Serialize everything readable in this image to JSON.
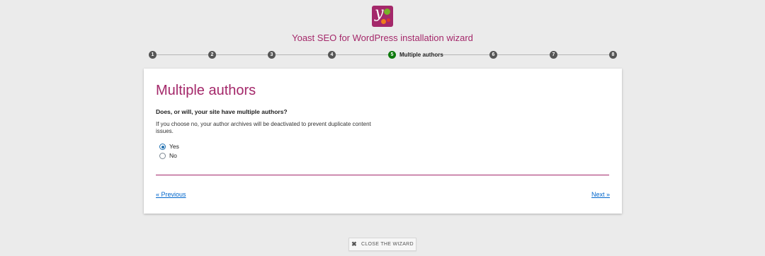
{
  "wizard": {
    "title": "Yoast SEO for WordPress installation wizard",
    "brand_color": "#a4286a",
    "logo_icon": "yoast-logo-icon"
  },
  "stepper": {
    "current_step": 5,
    "steps": [
      {
        "number": "1",
        "label": ""
      },
      {
        "number": "2",
        "label": ""
      },
      {
        "number": "3",
        "label": ""
      },
      {
        "number": "4",
        "label": ""
      },
      {
        "number": "5",
        "label": "Multiple authors"
      },
      {
        "number": "6",
        "label": ""
      },
      {
        "number": "7",
        "label": ""
      },
      {
        "number": "8",
        "label": ""
      }
    ],
    "active_color": "#0e7a0d",
    "inactive_color": "#555555"
  },
  "step": {
    "heading": "Multiple authors",
    "question": "Does, or will, your site have multiple authors?",
    "explanation": "If you choose no, your author archives will be deactivated to prevent duplicate content issues.",
    "options": [
      {
        "label": "Yes",
        "checked": true
      },
      {
        "label": "No",
        "checked": false
      }
    ]
  },
  "navigation": {
    "previous_label": "« Previous",
    "next_label": "Next »"
  },
  "footer": {
    "close_label": "CLOSE THE WIZARD",
    "close_icon": "close-icon"
  }
}
